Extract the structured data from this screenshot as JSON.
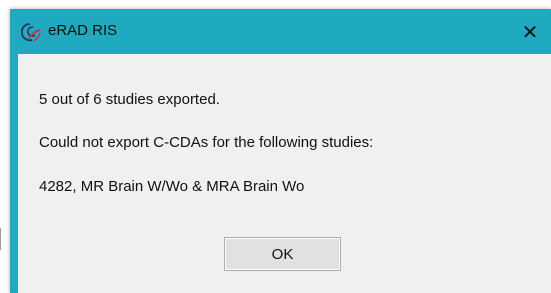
{
  "colors": {
    "titlebar": "#20aac0",
    "client_background": "#f0f0f0",
    "button_background": "#e1e1e1"
  },
  "dialog": {
    "title": "eRAD RIS",
    "app_icon": "erad-logo-icon",
    "close_icon": "close-icon",
    "close_label": "✕",
    "messages": [
      "5 out of 6 studies exported.",
      "Could not export C-CDAs for the following studies:",
      "4282, MR Brain W/Wo & MRA Brain Wo"
    ],
    "ok_label": "OK"
  }
}
